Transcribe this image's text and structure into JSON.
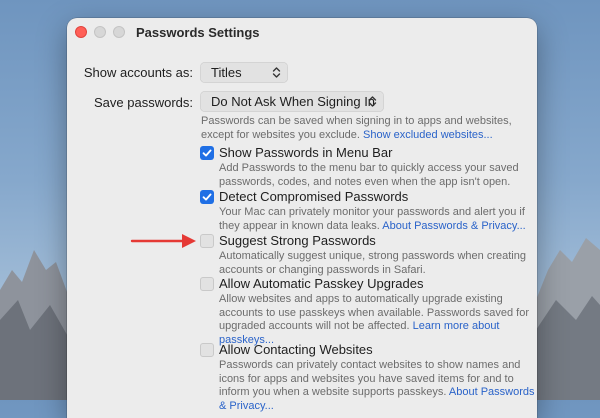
{
  "window": {
    "title": "Passwords Settings"
  },
  "show_accounts": {
    "label": "Show accounts as:",
    "value": "Titles"
  },
  "save_passwords": {
    "label": "Save passwords:",
    "value": "Do Not Ask When Signing In",
    "description_line1": "Passwords can be saved when signing in to apps and websites,",
    "description_line2": "except for websites you exclude. ",
    "link": "Show excluded websites..."
  },
  "options": [
    {
      "label": "Show Passwords in Menu Bar",
      "checked": true,
      "lines": [
        "Add Passwords to the menu bar to quickly access your saved",
        "passwords, codes, and notes even when the app isn't open."
      ]
    },
    {
      "label": "Detect Compromised Passwords",
      "checked": true,
      "lines": [
        "Your Mac can privately monitor your passwords and alert you if",
        "they appear in known data leaks. "
      ],
      "link": "About Passwords & Privacy..."
    },
    {
      "label": "Suggest Strong Passwords",
      "checked": false,
      "lines": [
        "Automatically suggest unique, strong passwords when creating",
        "accounts or changing passwords in Safari."
      ]
    },
    {
      "label": "Allow Automatic Passkey Upgrades",
      "checked": false,
      "lines": [
        "Allow websites and apps to automatically upgrade existing",
        "accounts to use passkeys when available. Passwords saved for",
        "upgraded accounts will not be affected. "
      ],
      "link": "Learn more about",
      "link2": "passkeys..."
    },
    {
      "label": "Allow Contacting Websites",
      "checked": false,
      "lines": [
        "Passwords can privately contact websites to show names and",
        "icons for apps and websites you have saved items for and to",
        "inform you when a website supports passkeys. "
      ],
      "link": "About Passwords",
      "link2": "& Privacy..."
    }
  ],
  "colors": {
    "accent": "#1f6fe5",
    "annotation_arrow": "#e53935"
  }
}
